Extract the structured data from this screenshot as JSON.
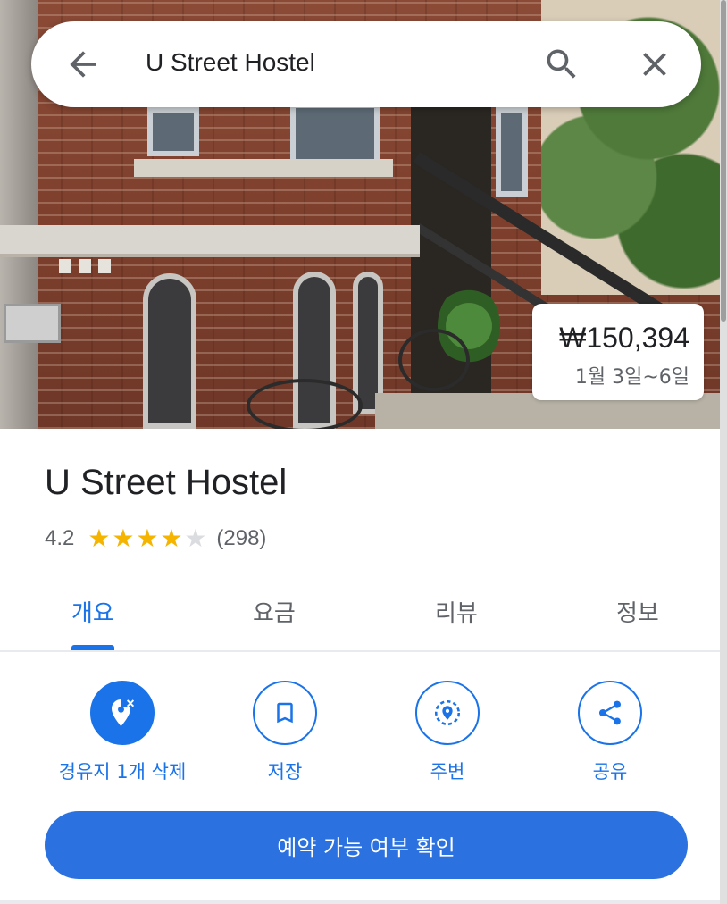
{
  "search": {
    "query": "U Street Hostel",
    "back_icon": "arrow-back-icon",
    "search_icon": "search-icon",
    "close_icon": "close-icon"
  },
  "price_card": {
    "price": "₩150,394",
    "dates": "1월 3일~6일"
  },
  "place": {
    "name": "U Street Hostel",
    "rating": "4.2",
    "rating_value": 4.2,
    "stars_filled": 4,
    "stars_total": 5,
    "review_count": "(298)"
  },
  "tabs": [
    {
      "label": "개요",
      "active": true
    },
    {
      "label": "요금",
      "active": false
    },
    {
      "label": "리뷰",
      "active": false
    },
    {
      "label": "정보",
      "active": false
    }
  ],
  "actions": [
    {
      "label": "경유지 1개 삭제",
      "icon": "remove-stop-icon",
      "filled": true
    },
    {
      "label": "저장",
      "icon": "bookmark-icon",
      "filled": false
    },
    {
      "label": "주변",
      "icon": "nearby-icon",
      "filled": false
    },
    {
      "label": "공유",
      "icon": "share-icon",
      "filled": false
    }
  ],
  "primary_button": {
    "label": "예약 가능 여부 확인"
  },
  "colors": {
    "accent": "#1a73e8",
    "star": "#f4b400",
    "star_empty": "#dadce0",
    "button": "#2b72e0"
  }
}
